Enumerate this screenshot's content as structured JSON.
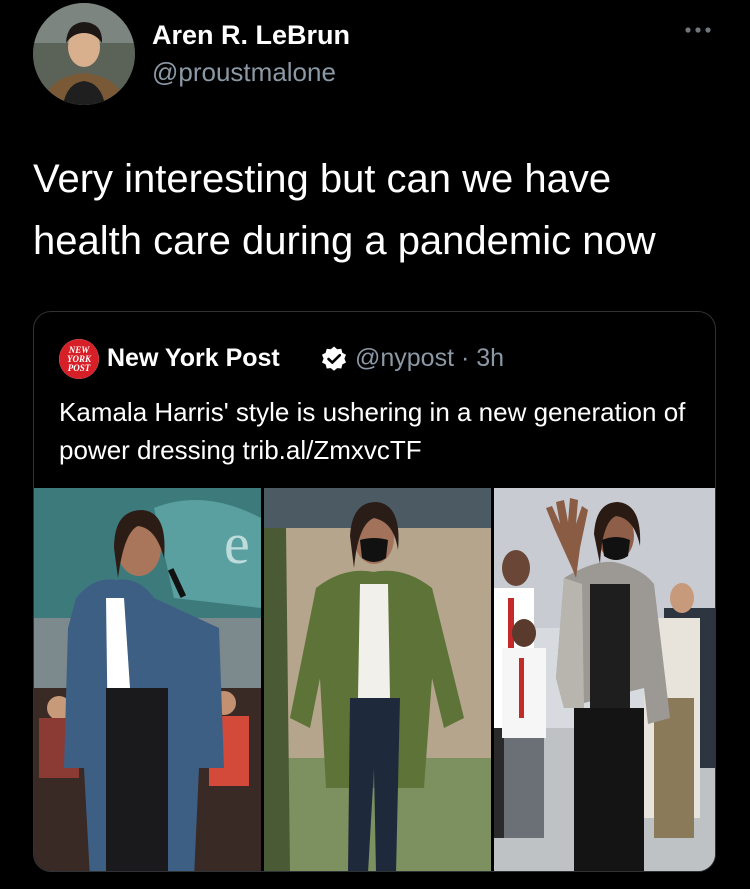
{
  "tweet": {
    "display_name": "Aren R. LeBrun",
    "handle": "@proustmalone",
    "text": "Very interesting but can we have health care during a pandemic now",
    "more_icon": "more-horizontal-icon",
    "avatar_icon": "user-avatar-photo"
  },
  "quoted_tweet": {
    "name": "New York Post",
    "handle_time": "@nypost · 3h",
    "text": "Kamala Harris' style is ushering in a new generation of power dressing trib.al/ZmxvcTF",
    "logo_text": [
      "NEW",
      "YORK",
      "POST"
    ],
    "verified_icon": "verified-badge-icon",
    "photos": [
      "photo-blue-blazer-stage",
      "photo-green-jacket-field",
      "photo-plaid-blazer-waving"
    ]
  },
  "colors": {
    "background": "#000000",
    "primary_text": "#ffffff",
    "secondary_text": "#8b98a5",
    "border": "#2f3336",
    "nypost_red": "#d61f26"
  }
}
